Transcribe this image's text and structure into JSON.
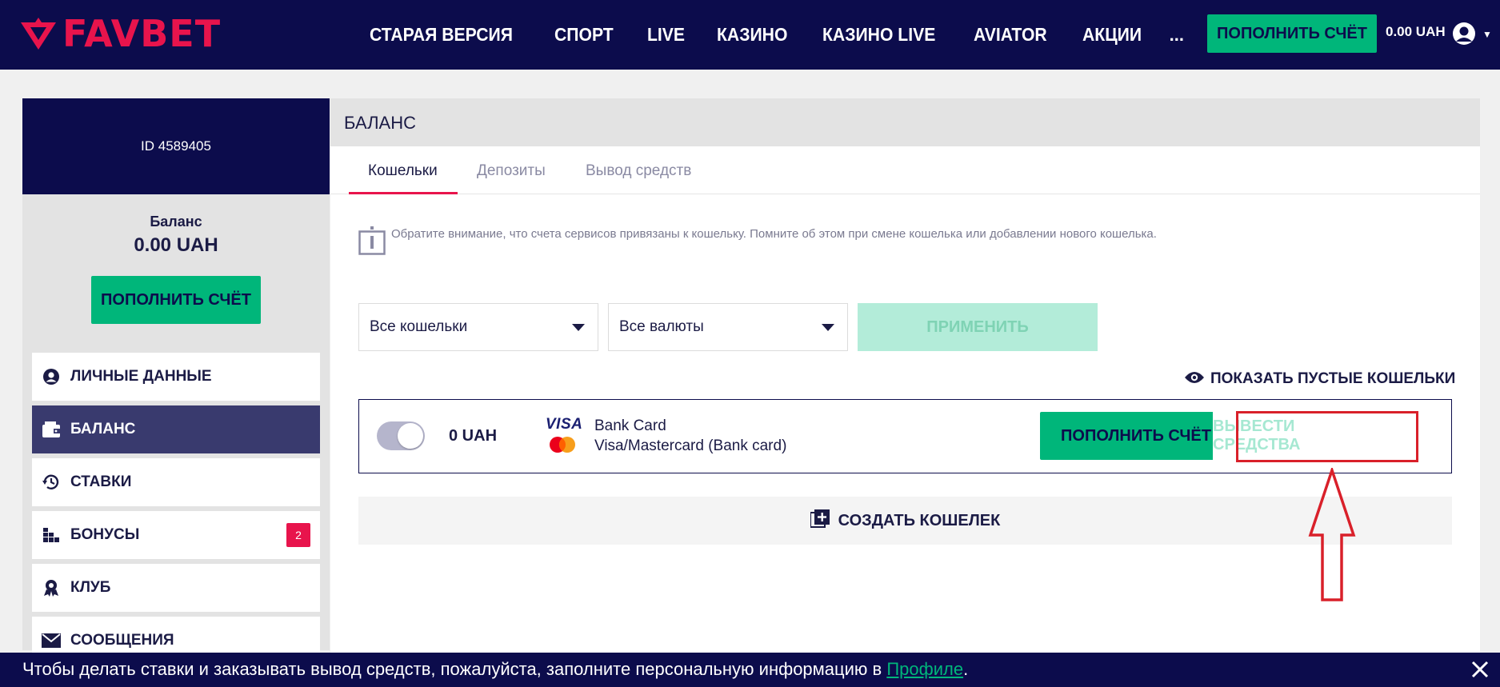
{
  "header": {
    "logo_text": "FAVBET",
    "nav": [
      {
        "label": "СТАРАЯ ВЕРСИЯ"
      },
      {
        "label": "СПОРТ"
      },
      {
        "label": "LIVE"
      },
      {
        "label": "КАЗИНО"
      },
      {
        "label": "КАЗИНО LIVE"
      },
      {
        "label": "AVIATOR"
      },
      {
        "label": "АКЦИИ"
      }
    ],
    "nav_more": "...",
    "deposit_label": "ПОПОЛНИТЬ СЧЁТ",
    "balance": "0.00 UAH",
    "icons": {
      "user": "user-icon",
      "caret": "chevron-down-icon"
    }
  },
  "sidebar": {
    "user_id": "ID 4589405",
    "balance_label": "Баланс",
    "balance_value": "0.00 UAH",
    "deposit_label": "ПОПОЛНИТЬ СЧЁТ",
    "items": [
      {
        "label": "ЛИЧНЫЕ ДАННЫЕ",
        "icon": "user-icon"
      },
      {
        "label": "БАЛАНС",
        "icon": "wallet-icon",
        "active": true
      },
      {
        "label": "СТАВКИ",
        "icon": "history-icon"
      },
      {
        "label": "БОНУСЫ",
        "icon": "gift-icon",
        "badge": "2"
      },
      {
        "label": "КЛУБ",
        "icon": "award-icon"
      },
      {
        "label": "СООБЩЕНИЯ",
        "icon": "envelope-icon"
      }
    ]
  },
  "main": {
    "title": "БАЛАНС",
    "tabs": [
      {
        "label": "Кошельки",
        "active": true
      },
      {
        "label": "Депозиты"
      },
      {
        "label": "Вывод средств"
      }
    ],
    "notice": "Обратите внимание, что счета сервисов привязаны к кошельку. Помните об этом при смене кошелька или добавлении нового кошелька.",
    "filters": {
      "wallet_select": "Все кошельки",
      "currency_select": "Все валюты",
      "apply_label": "ПРИМЕНИТЬ"
    },
    "show_empty_label": "ПОКАЗАТЬ ПУСТЫЕ КОШЕЛЬКИ",
    "wallet": {
      "amount": "0 UAH",
      "visa_text": "VISA",
      "card_name": "Bank Card",
      "card_type": "Visa/Mastercard (Bank card)",
      "deposit_label": "ПОПОЛНИТЬ СЧЁТ",
      "withdraw_label": "ВЫВЕСТИ СРЕДСТВА"
    },
    "create_wallet_label": "СОЗДАТЬ КОШЕЛЕК"
  },
  "banner": {
    "text": "Чтобы делать ставки и заказывать вывод средств, пожалуйста, заполните персональную информацию в ",
    "link": "Профиле",
    "suffix": "."
  },
  "colors": {
    "navy": "#0c0c4c",
    "green": "#00b67a",
    "pink": "#e8144c",
    "highlight_red": "#d9202a"
  }
}
